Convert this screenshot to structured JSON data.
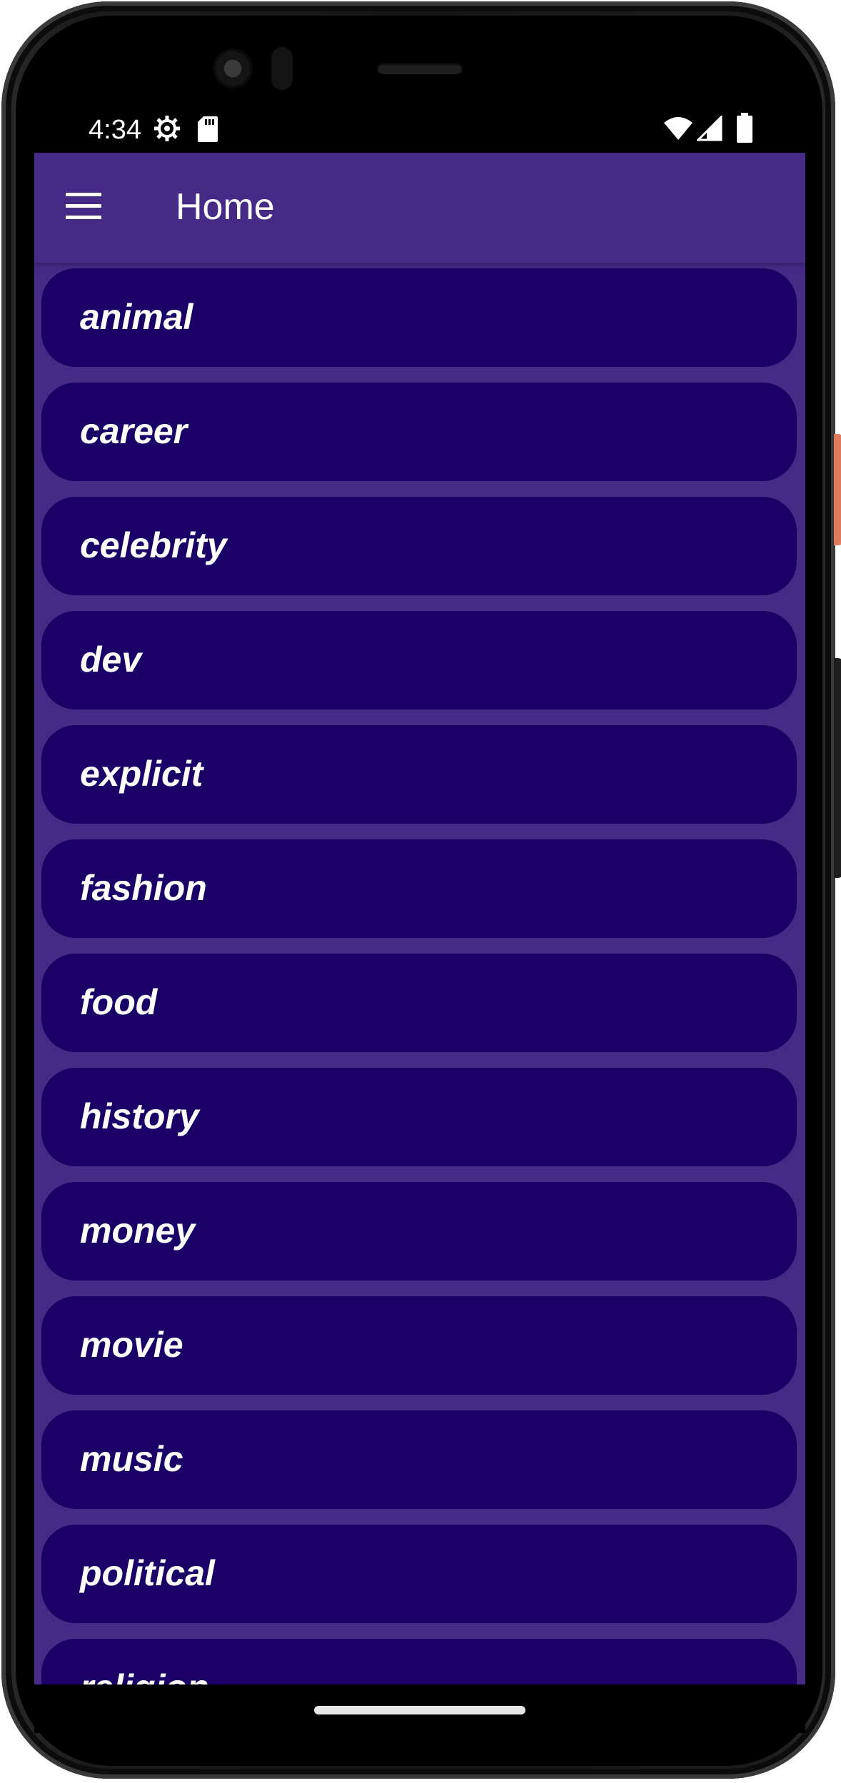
{
  "status_bar": {
    "time": "4:34",
    "icons": [
      "gear-icon",
      "sd-card-icon",
      "wifi-icon",
      "signal-icon",
      "battery-icon"
    ]
  },
  "app_bar": {
    "title": "Home",
    "menu_icon": "hamburger-menu-icon"
  },
  "colors": {
    "app_bar": "#452a86",
    "background": "#452a86",
    "item_background": "#1a0066",
    "text": "#ffffff"
  },
  "categories": [
    "animal",
    "career",
    "celebrity",
    "dev",
    "explicit",
    "fashion",
    "food",
    "history",
    "money",
    "movie",
    "music",
    "political",
    "religion"
  ]
}
